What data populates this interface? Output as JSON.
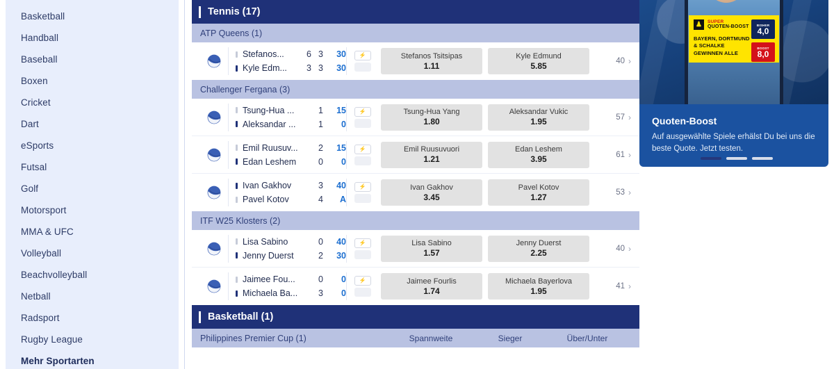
{
  "sidebar": {
    "items": [
      {
        "label": "Basketball",
        "bold": false
      },
      {
        "label": "Handball",
        "bold": false
      },
      {
        "label": "Baseball",
        "bold": false
      },
      {
        "label": "Boxen",
        "bold": false
      },
      {
        "label": "Cricket",
        "bold": false
      },
      {
        "label": "Dart",
        "bold": false
      },
      {
        "label": "eSports",
        "bold": false
      },
      {
        "label": "Futsal",
        "bold": false
      },
      {
        "label": "Golf",
        "bold": false
      },
      {
        "label": "Motorsport",
        "bold": false
      },
      {
        "label": "MMA & UFC",
        "bold": false
      },
      {
        "label": "Volleyball",
        "bold": false
      },
      {
        "label": "Beachvolleyball",
        "bold": false
      },
      {
        "label": "Netball",
        "bold": false
      },
      {
        "label": "Radsport",
        "bold": false
      },
      {
        "label": "Rugby League",
        "bold": false
      },
      {
        "label": "Mehr Sportarten",
        "bold": true
      }
    ]
  },
  "main": {
    "sections": [
      {
        "sport": "Tennis (17)",
        "leagues": [
          {
            "name": "ATP Queens (1)",
            "markets": [],
            "matches": [
              {
                "icon": "tennis-ball-icon",
                "players": [
                  {
                    "name": "Stefanos...",
                    "serving": false,
                    "sets": [
                      "6",
                      "3"
                    ],
                    "points": "30"
                  },
                  {
                    "name": "Kyle Edm...",
                    "serving": true,
                    "sets": [
                      "3",
                      "3"
                    ],
                    "points": "30"
                  }
                ],
                "odds": [
                  {
                    "name": "Stefanos Tsitsipas",
                    "value": "1.11"
                  },
                  {
                    "name": "Kyle Edmund",
                    "value": "5.85"
                  }
                ],
                "more_count": "40"
              }
            ]
          },
          {
            "name": "Challenger Fergana (3)",
            "markets": [],
            "matches": [
              {
                "icon": "tennis-ball-icon",
                "players": [
                  {
                    "name": "Tsung-Hua ...",
                    "serving": false,
                    "sets": [
                      "1"
                    ],
                    "points": "15"
                  },
                  {
                    "name": "Aleksandar ...",
                    "serving": true,
                    "sets": [
                      "1"
                    ],
                    "points": "0"
                  }
                ],
                "odds": [
                  {
                    "name": "Tsung-Hua Yang",
                    "value": "1.80"
                  },
                  {
                    "name": "Aleksandar Vukic",
                    "value": "1.95"
                  }
                ],
                "more_count": "57"
              },
              {
                "icon": "tennis-ball-icon",
                "players": [
                  {
                    "name": "Emil Ruusuv...",
                    "serving": false,
                    "sets": [
                      "2"
                    ],
                    "points": "15"
                  },
                  {
                    "name": "Edan Leshem",
                    "serving": true,
                    "sets": [
                      "0"
                    ],
                    "points": "0"
                  }
                ],
                "odds": [
                  {
                    "name": "Emil Ruusuvuori",
                    "value": "1.21"
                  },
                  {
                    "name": "Edan Leshem",
                    "value": "3.95"
                  }
                ],
                "more_count": "61"
              },
              {
                "icon": "tennis-ball-icon",
                "players": [
                  {
                    "name": "Ivan Gakhov",
                    "serving": true,
                    "sets": [
                      "3"
                    ],
                    "points": "40"
                  },
                  {
                    "name": "Pavel Kotov",
                    "serving": false,
                    "sets": [
                      "4"
                    ],
                    "points": "A"
                  }
                ],
                "odds": [
                  {
                    "name": "Ivan Gakhov",
                    "value": "3.45"
                  },
                  {
                    "name": "Pavel Kotov",
                    "value": "1.27"
                  }
                ],
                "more_count": "53"
              }
            ]
          },
          {
            "name": "ITF W25 Klosters (2)",
            "markets": [],
            "matches": [
              {
                "icon": "tennis-ball-icon",
                "players": [
                  {
                    "name": "Lisa Sabino",
                    "serving": false,
                    "sets": [
                      "0"
                    ],
                    "points": "40"
                  },
                  {
                    "name": "Jenny Duerst",
                    "serving": true,
                    "sets": [
                      "2"
                    ],
                    "points": "30"
                  }
                ],
                "odds": [
                  {
                    "name": "Lisa Sabino",
                    "value": "1.57"
                  },
                  {
                    "name": "Jenny Duerst",
                    "value": "2.25"
                  }
                ],
                "more_count": "40"
              },
              {
                "icon": "tennis-ball-icon",
                "players": [
                  {
                    "name": "Jaimee Fou...",
                    "serving": false,
                    "sets": [
                      "0"
                    ],
                    "points": "0"
                  },
                  {
                    "name": "Michaela Ba...",
                    "serving": true,
                    "sets": [
                      "3"
                    ],
                    "points": "0"
                  }
                ],
                "odds": [
                  {
                    "name": "Jaimee Fourlis",
                    "value": "1.74"
                  },
                  {
                    "name": "Michaela Bayerlova",
                    "value": "1.95"
                  }
                ],
                "more_count": "41"
              }
            ]
          }
        ]
      },
      {
        "sport": "Basketball (1)",
        "leagues": [
          {
            "name": "Philippines Premier Cup (1)",
            "markets": [
              "Spannweite",
              "Sieger",
              "Über/Unter"
            ],
            "matches": []
          }
        ]
      }
    ]
  },
  "promo": {
    "title": "Quoten-Boost",
    "subtitle": "Auf ausgewählte Spiele erhälst Du bei uns die beste Quote. Jetzt testen.",
    "card": {
      "logo_glyph": "♟",
      "super": "SUPER",
      "name": "QUOTEN-BOOST",
      "headline": "BAYERN, DORTMUND & SCHALKE GEWINNEN ALLE",
      "badges": [
        {
          "label": "BISHER",
          "value": "4,0",
          "style": "dark"
        },
        {
          "label": "BOOST",
          "value": "8,0",
          "style": "red"
        }
      ]
    },
    "dots": [
      true,
      false,
      false
    ]
  },
  "icons": {
    "stats_bolt": "⚡",
    "chevron": "›"
  }
}
